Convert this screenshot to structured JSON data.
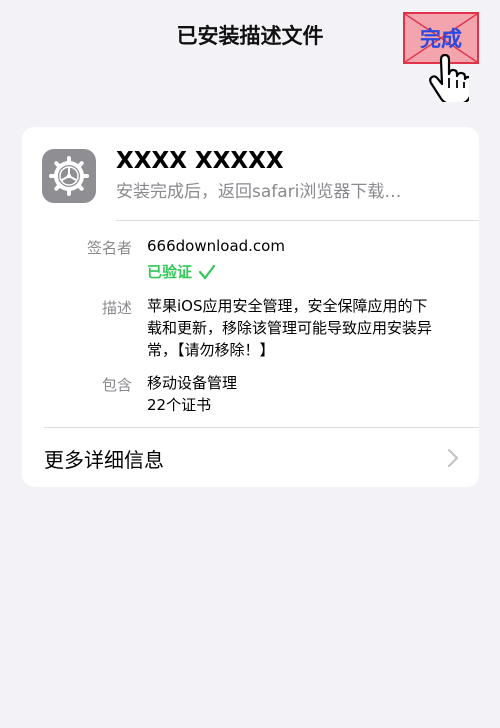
{
  "nav": {
    "title": "已安装描述文件",
    "done_label": "完成"
  },
  "profile": {
    "name": "XXXX XXXXX",
    "subtitle": "安装完成后，返回safari浏览器下载…",
    "icon": "gear-icon"
  },
  "details": {
    "signer_label": "签名者",
    "signer_value": "666download.com",
    "verified_label": "已验证",
    "description_label": "描述",
    "description_lines": [
      "苹果iOS应用安全管理，安全保障应用的下",
      "载和更新，移除该管理可能导致应用安装异",
      "常，【请勿移除！】"
    ],
    "contains_label": "包含",
    "contains_lines": [
      "移动设备管理",
      "22个证书"
    ]
  },
  "more": {
    "label": "更多详细信息"
  },
  "colors": {
    "background": "#f2f2f7",
    "accent_blue": "#2b49e0",
    "verified_green": "#34c759",
    "secondary_text": "#8a8a8e",
    "highlight_fill": "#f3a4ad",
    "highlight_border": "#e0344b"
  }
}
